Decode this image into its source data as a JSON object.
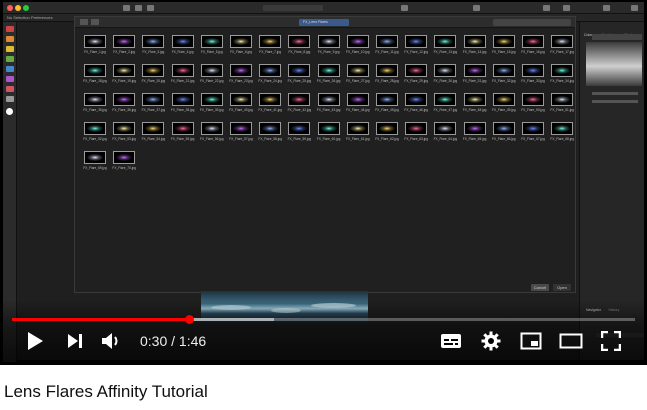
{
  "app": {
    "context_left": "No Selection",
    "context_mid": "Preferences",
    "tab_label": "Lens Flares",
    "doc_label": "Untitled - 1",
    "folder_label": "FX_Lens Flares",
    "dialog_cancel": "Cancel",
    "dialog_open": "Open",
    "panel_tabs": [
      "Colour",
      "Swatches",
      "Stroke"
    ],
    "lower_tabs": [
      "Navigator",
      "History"
    ]
  },
  "files": [
    "FX_Flare_1.jpg",
    "FX_Flare_2.jpg",
    "FX_Flare_3.jpg",
    "FX_Flare_4.jpg",
    "FX_Flare_5.jpg",
    "FX_Flare_6.jpg",
    "FX_Flare_7.jpg",
    "FX_Flare_8.jpg",
    "FX_Flare_9.jpg",
    "FX_Flare_10.jpg",
    "FX_Flare_11.jpg",
    "FX_Flare_12.jpg",
    "FX_Flare_13.jpg",
    "FX_Flare_14.jpg",
    "FX_Flare_15.jpg",
    "FX_Flare_16.jpg",
    "FX_Flare_17.jpg",
    "FX_Flare_18.jpg",
    "FX_Flare_19.jpg",
    "FX_Flare_20.jpg",
    "FX_Flare_21.jpg",
    "FX_Flare_22.jpg",
    "FX_Flare_23.jpg",
    "FX_Flare_24.jpg",
    "FX_Flare_25.jpg",
    "FX_Flare_26.jpg",
    "FX_Flare_27.jpg",
    "FX_Flare_28.jpg",
    "FX_Flare_29.jpg",
    "FX_Flare_30.jpg",
    "FX_Flare_31.jpg",
    "FX_Flare_32.jpg",
    "FX_Flare_33.jpg",
    "FX_Flare_34.jpg",
    "FX_Flare_35.jpg",
    "FX_Flare_36.jpg",
    "FX_Flare_37.jpg",
    "FX_Flare_38.jpg",
    "FX_Flare_39.jpg",
    "FX_Flare_40.jpg",
    "FX_Flare_41.jpg",
    "FX_Flare_42.jpg",
    "FX_Flare_43.jpg",
    "FX_Flare_44.jpg",
    "FX_Flare_45.jpg",
    "FX_Flare_46.jpg",
    "FX_Flare_47.jpg",
    "FX_Flare_48.jpg",
    "FX_Flare_49.jpg",
    "FX_Flare_50.jpg",
    "FX_Flare_51.jpg",
    "FX_Flare_52.jpg",
    "FX_Flare_53.jpg",
    "FX_Flare_54.jpg",
    "FX_Flare_55.jpg",
    "FX_Flare_56.jpg",
    "FX_Flare_57.jpg",
    "FX_Flare_58.jpg",
    "FX_Flare_59.jpg",
    "FX_Flare_60.jpg",
    "FX_Flare_61.jpg",
    "FX_Flare_62.jpg",
    "FX_Flare_63.jpg",
    "FX_Flare_64.jpg",
    "FX_Flare_65.jpg",
    "FX_Flare_66.jpg",
    "FX_Flare_67.jpg",
    "FX_Flare_68.jpg",
    "FX_Flare_69.jpg",
    "FX_Flare_70.jpg"
  ],
  "flare_colors": [
    "#dfe8ff",
    "#6b8cff",
    "#ffd86b",
    "#c86bff",
    "#6bffe6",
    "#ff6b9c",
    "#8fb4ff",
    "#fff2a8"
  ],
  "player": {
    "current_time": "0:30",
    "separator": " / ",
    "duration": "1:46",
    "progress": 0.285,
    "buffered": 0.42,
    "accent": "#ff0000"
  },
  "controls": {
    "play": "play-icon",
    "next": "next-icon",
    "volume": "volume-icon",
    "captions": "subtitles-icon",
    "settings": "gear-icon",
    "miniplayer": "miniplayer-icon",
    "theater": "theater-icon",
    "fullscreen": "fullscreen-icon"
  },
  "video_title": "Lens Flares Affinity Tutorial"
}
